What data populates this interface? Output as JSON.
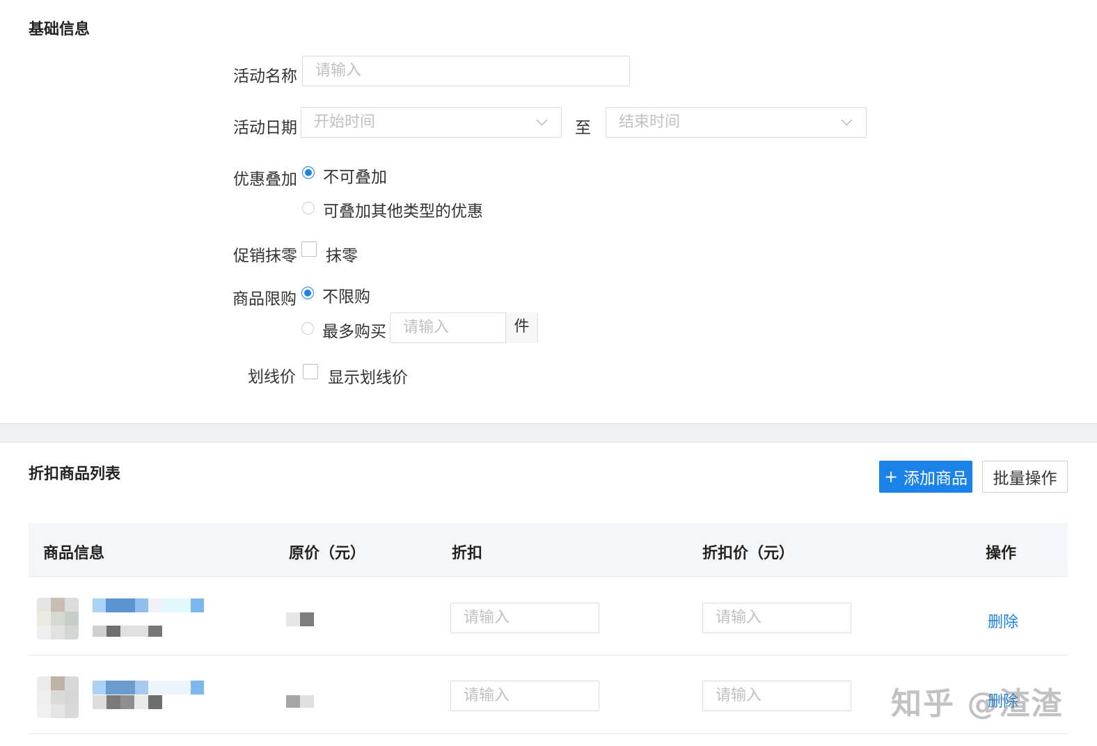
{
  "basic_info": {
    "title": "基础信息",
    "activity_name": {
      "label": "活动名称",
      "placeholder": "请输入"
    },
    "activity_date": {
      "label": "活动日期",
      "start_placeholder": "开始时间",
      "separator": "至",
      "end_placeholder": "结束时间"
    },
    "discount_stack": {
      "label": "优惠叠加",
      "options": [
        "不可叠加",
        "可叠加其他类型的优惠"
      ],
      "selected": "不可叠加"
    },
    "rounding": {
      "label": "促销抹零",
      "option": "抹零",
      "checked": false
    },
    "purchase_limit": {
      "label": "商品限购",
      "options": [
        "不限购",
        "最多购买"
      ],
      "selected": "不限购",
      "max_placeholder": "请输入",
      "unit": "件"
    },
    "strike_price": {
      "label": "划线价",
      "option": "显示划线价",
      "checked": false
    }
  },
  "product_list": {
    "title": "折扣商品列表",
    "add_button": "添加商品",
    "add_icon": "+",
    "batch_button": "批量操作",
    "columns": [
      "商品信息",
      "原价（元）",
      "折扣",
      "折扣价（元）",
      "操作"
    ],
    "rows": [
      {
        "discount_placeholder": "请输入",
        "discount_price_placeholder": "请输入",
        "action": "删除"
      },
      {
        "discount_placeholder": "请输入",
        "discount_price_placeholder": "请输入",
        "action": "删除"
      }
    ]
  },
  "watermark": "知乎 @渣渣",
  "colors": {
    "primary": "#1a82e8",
    "band": "#f0f1f3",
    "header_bg": "#f5f6f8"
  }
}
